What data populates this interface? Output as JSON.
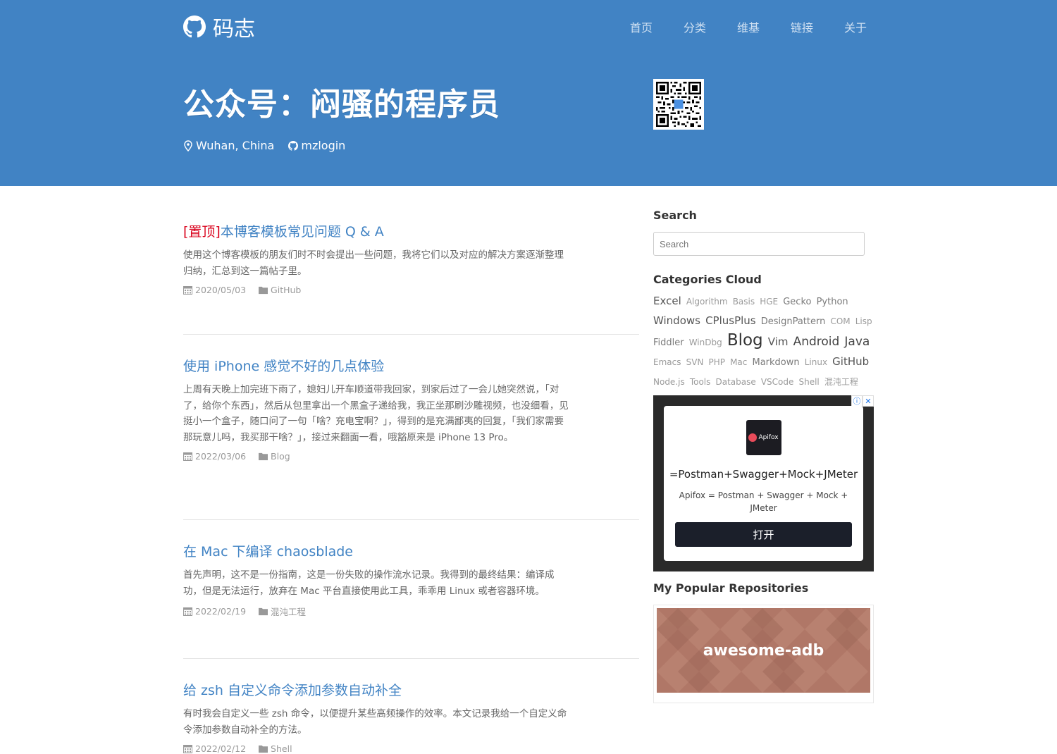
{
  "site": {
    "brand": "码志"
  },
  "nav": {
    "items": [
      "首页",
      "分类",
      "维基",
      "链接",
      "关于"
    ]
  },
  "hero": {
    "title": "公众号：闷骚的程序员",
    "location": "Wuhan, China",
    "github": "mzlogin"
  },
  "posts": [
    {
      "pin": "[置顶]",
      "title": "本博客模板常见问题 Q & A",
      "excerpt": "使用这个博客模板的朋友们时不时会提出一些问题，我将它们以及对应的解决方案逐渐整理归纳，汇总到这一篇帖子里。",
      "date": "2020/05/03",
      "category": "GitHub"
    },
    {
      "pin": "",
      "title": "使用 iPhone 感觉不好的几点体验",
      "excerpt": "上周有天晚上加完班下雨了，媳妇儿开车顺道带我回家，到家后过了一会儿她突然说，「对了，给你个东西」，然后从包里拿出一个黑盒子递给我，我正坐那刷沙雕视频，也没细看，见挺小一个盒子，随口问了一句「啥？充电宝啊？」，得到的是充满鄙夷的回复，「我们家需要那玩意儿吗，我买那干啥？」，接过来翻面一看，哦豁原来是 iPhone 13 Pro。",
      "date": "2022/03/06",
      "category": "Blog"
    },
    {
      "pin": "",
      "title": "在 Mac 下编译 chaosblade",
      "excerpt": "首先声明，这不是一份指南，这是一份失败的操作流水记录。我得到的最终结果：编译成功，但是无法运行，放弃在 Mac 平台直接使用此工具，乖乖用 Linux 或者容器环境。",
      "date": "2022/02/19",
      "category": "混沌工程"
    },
    {
      "pin": "",
      "title": "给 zsh 自定义命令添加参数自动补全",
      "excerpt": "有时我会自定义一些 zsh 命令，以便提升某些高频操作的效率。本文记录我给一个自定义命令添加参数自动补全的方法。",
      "date": "2022/02/12",
      "category": "Shell"
    }
  ],
  "sidebar": {
    "search_title": "Search",
    "search_placeholder": "Search",
    "cloud_title": "Categories Cloud",
    "categories": [
      {
        "name": "Excel",
        "weight": 3
      },
      {
        "name": "Algorithm",
        "weight": 1
      },
      {
        "name": "Basis",
        "weight": 1
      },
      {
        "name": "HGE",
        "weight": 1
      },
      {
        "name": "Gecko",
        "weight": 2
      },
      {
        "name": "Python",
        "weight": 2
      },
      {
        "name": "Windows",
        "weight": 3
      },
      {
        "name": "CPlusPlus",
        "weight": 3
      },
      {
        "name": "DesignPattern",
        "weight": 2
      },
      {
        "name": "COM",
        "weight": 1
      },
      {
        "name": "Lisp",
        "weight": 1
      },
      {
        "name": "Fiddler",
        "weight": 2
      },
      {
        "name": "WinDbg",
        "weight": 1
      },
      {
        "name": "Blog",
        "weight": 5
      },
      {
        "name": "Vim",
        "weight": 3
      },
      {
        "name": "Android",
        "weight": 4
      },
      {
        "name": "Java",
        "weight": 4
      },
      {
        "name": "Emacs",
        "weight": 1
      },
      {
        "name": "SVN",
        "weight": 1
      },
      {
        "name": "PHP",
        "weight": 1
      },
      {
        "name": "Mac",
        "weight": 1
      },
      {
        "name": "Markdown",
        "weight": 2
      },
      {
        "name": "Linux",
        "weight": 1
      },
      {
        "name": "GitHub",
        "weight": 3
      },
      {
        "name": "Node.js",
        "weight": 1
      },
      {
        "name": "Tools",
        "weight": 1
      },
      {
        "name": "Database",
        "weight": 1
      },
      {
        "name": "VSCode",
        "weight": 1
      },
      {
        "name": "Shell",
        "weight": 1
      },
      {
        "name": "混沌工程",
        "weight": 1
      }
    ],
    "ad": {
      "logo": "Apifox",
      "headline": "=Postman+Swagger+Mock+JMeter",
      "sub": "Apifox = Postman + Swagger + Mock + JMeter",
      "button": "打开"
    },
    "repos_title": "My Popular Repositories",
    "repo_name": "awesome-adb"
  },
  "colors": {
    "header_bg": "#4183c4",
    "link": "#4183c4",
    "pin": "#d9001b"
  }
}
